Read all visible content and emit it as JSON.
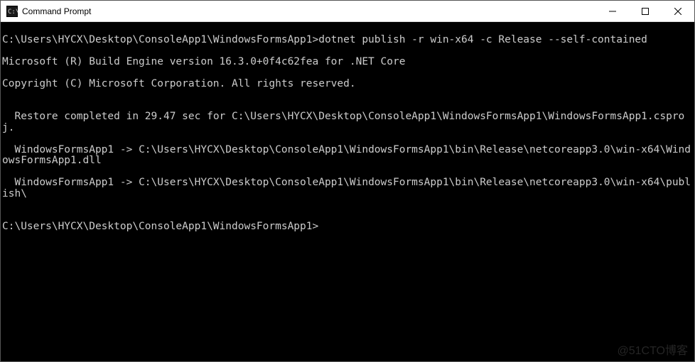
{
  "window": {
    "title": "Command Prompt"
  },
  "terminal": {
    "prompt1_path": "C:\\Users\\HYCX\\Desktop\\ConsoleApp1\\WindowsFormsApp1>",
    "prompt1_cmd": "dotnet publish -r win-x64 -c Release --self-contained",
    "line_engine": "Microsoft (R) Build Engine version 16.3.0+0f4c62fea for .NET Core",
    "line_copyright": "Copyright (C) Microsoft Corporation. All rights reserved.",
    "blank": "",
    "line_restore": "  Restore completed in 29.47 sec for C:\\Users\\HYCX\\Desktop\\ConsoleApp1\\WindowsFormsApp1\\WindowsFormsApp1.csproj.",
    "line_out1": "  WindowsFormsApp1 -> C:\\Users\\HYCX\\Desktop\\ConsoleApp1\\WindowsFormsApp1\\bin\\Release\\netcoreapp3.0\\win-x64\\WindowsFormsApp1.dll",
    "line_out2": "  WindowsFormsApp1 -> C:\\Users\\HYCX\\Desktop\\ConsoleApp1\\WindowsFormsApp1\\bin\\Release\\netcoreapp3.0\\win-x64\\publish\\",
    "prompt2_path": "C:\\Users\\HYCX\\Desktop\\ConsoleApp1\\WindowsFormsApp1>",
    "prompt2_cmd": ""
  },
  "watermark": "@51CTO博客"
}
